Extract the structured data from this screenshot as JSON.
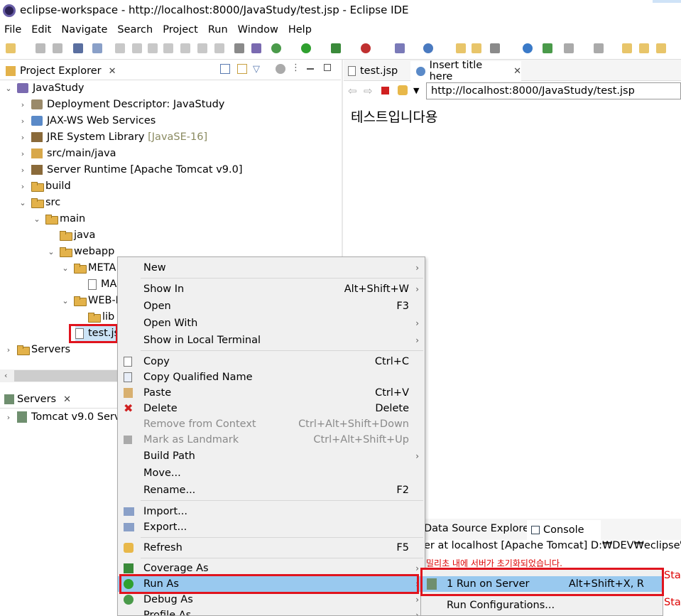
{
  "window": {
    "title": "eclipse-workspace - http://localhost:8000/JavaStudy/test.jsp - Eclipse IDE"
  },
  "menubar": [
    "File",
    "Edit",
    "Navigate",
    "Search",
    "Project",
    "Run",
    "Window",
    "Help"
  ],
  "project_explorer": {
    "tab_label": "Project Explorer",
    "tree": [
      {
        "label": "JavaStudy"
      },
      {
        "label": "Deployment Descriptor: JavaStudy"
      },
      {
        "label": "JAX-WS Web Services"
      },
      {
        "label": "JRE System Library",
        "suffix": "[JavaSE-16]"
      },
      {
        "label": "src/main/java"
      },
      {
        "label": "Server Runtime [Apache Tomcat v9.0]"
      },
      {
        "label": "build"
      },
      {
        "label": "src"
      },
      {
        "label": "main"
      },
      {
        "label": "java"
      },
      {
        "label": "webapp"
      },
      {
        "label": "META"
      },
      {
        "label": "MA"
      },
      {
        "label": "WEB-I"
      },
      {
        "label": "lib"
      },
      {
        "label": "test.js"
      },
      {
        "label": "Servers"
      }
    ]
  },
  "servers_view": {
    "tab_label": "Servers",
    "item": "Tomcat v9.0 Serve"
  },
  "editor": {
    "tabs": [
      "test.jsp",
      "Insert title here"
    ],
    "url": "http://localhost:8000/JavaStudy/test.jsp",
    "page_text": "테스트입니다용"
  },
  "context_menu": {
    "items": [
      {
        "label": "New",
        "shortcut": "",
        "submenu": true
      },
      {
        "label": "Show In",
        "shortcut": "Alt+Shift+W",
        "submenu": true
      },
      {
        "label": "Open",
        "shortcut": "F3"
      },
      {
        "label": "Open With",
        "shortcut": "",
        "submenu": true
      },
      {
        "label": "Show in Local Terminal",
        "shortcut": "",
        "submenu": true
      },
      {
        "label": "Copy",
        "shortcut": "Ctrl+C"
      },
      {
        "label": "Copy Qualified Name",
        "shortcut": ""
      },
      {
        "label": "Paste",
        "shortcut": "Ctrl+V"
      },
      {
        "label": "Delete",
        "shortcut": "Delete"
      },
      {
        "label": "Remove from Context",
        "shortcut": "Ctrl+Alt+Shift+Down",
        "disabled": true
      },
      {
        "label": "Mark as Landmark",
        "shortcut": "Ctrl+Alt+Shift+Up",
        "disabled": true
      },
      {
        "label": "Build Path",
        "shortcut": "",
        "submenu": true
      },
      {
        "label": "Move...",
        "shortcut": ""
      },
      {
        "label": "Rename...",
        "shortcut": "F2"
      },
      {
        "label": "Import...",
        "shortcut": ""
      },
      {
        "label": "Export...",
        "shortcut": ""
      },
      {
        "label": "Refresh",
        "shortcut": "F5"
      },
      {
        "label": "Coverage As",
        "shortcut": "",
        "submenu": true
      },
      {
        "label": "Run As",
        "shortcut": "",
        "submenu": true,
        "highlighted": true
      },
      {
        "label": "Debug As",
        "shortcut": "",
        "submenu": true
      },
      {
        "label": "Profile As",
        "shortcut": "",
        "submenu": true
      }
    ]
  },
  "run_as_submenu": {
    "items": [
      {
        "label": "1 Run on Server",
        "shortcut": "Alt+Shift+X, R"
      },
      {
        "label": "Run Configurations...",
        "shortcut": ""
      }
    ]
  },
  "bottom_panel": {
    "tabs": [
      "Data Source Explorer",
      "Console"
    ],
    "console_header": "er at localhost [Apache Tomcat] D:₩DEV₩eclipse₩plu",
    "console_red": "밀리초 내에 서버가 초기화되었습니다.",
    "right_edge_1": "Sta",
    "right_edge_2": "Sta"
  },
  "highlight_color": "#e0141e",
  "menu_highlight": "#99c9ef"
}
